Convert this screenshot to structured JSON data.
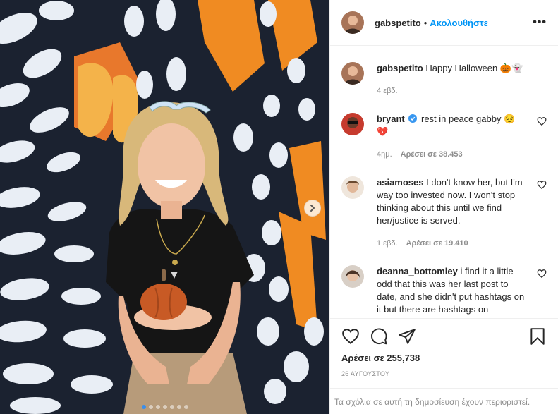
{
  "post": {
    "username": "gabspetito",
    "follow_label": "Ακολουθήστε",
    "more_label": "•••",
    "caption": {
      "username": "gabspetito",
      "text": "Happy Halloween 🎃👻",
      "time": "4 εβδ."
    },
    "comments": [
      {
        "username": "bryant",
        "verified": true,
        "text": "rest in peace gabby 😔 💔",
        "time": "4ημ.",
        "likes": "Αρέσει σε 38.453"
      },
      {
        "username": "asiamoses",
        "verified": false,
        "text": "I don't know her, but I'm way too invested now. I won't stop thinking about this until we find her/justice is served.",
        "time": "1 εβδ.",
        "likes": "Αρέσει σε 19.410"
      },
      {
        "username": "deanna_bottomley",
        "verified": false,
        "text": "i find it a little odd that this was her last post to date, and she didn't put hashtags on it but there are hashtags on",
        "time": "",
        "likes": ""
      }
    ],
    "likes_label": "Αρέσει σε 255,738",
    "date": "26 ΑΥΓΟΥΣΤΟΥ",
    "comments_disabled": "Τα σχόλια σε αυτή τη δημοσίευση έχουν περιοριστεί."
  },
  "carousel": {
    "dot_count": 7,
    "active_index": 0
  },
  "icons": {
    "more": "more-icon",
    "heart": "heart-icon",
    "comment": "comment-icon",
    "share": "share-icon",
    "save": "bookmark-icon",
    "next": "chevron-right-icon",
    "verified": "verified-badge-icon"
  },
  "colors": {
    "follow": "#0095f6",
    "verified": "#3897f0",
    "muted": "#8e8e8e",
    "border": "#efefef",
    "mural_dark": "#1b2230",
    "mural_orange": "#f08b22"
  }
}
